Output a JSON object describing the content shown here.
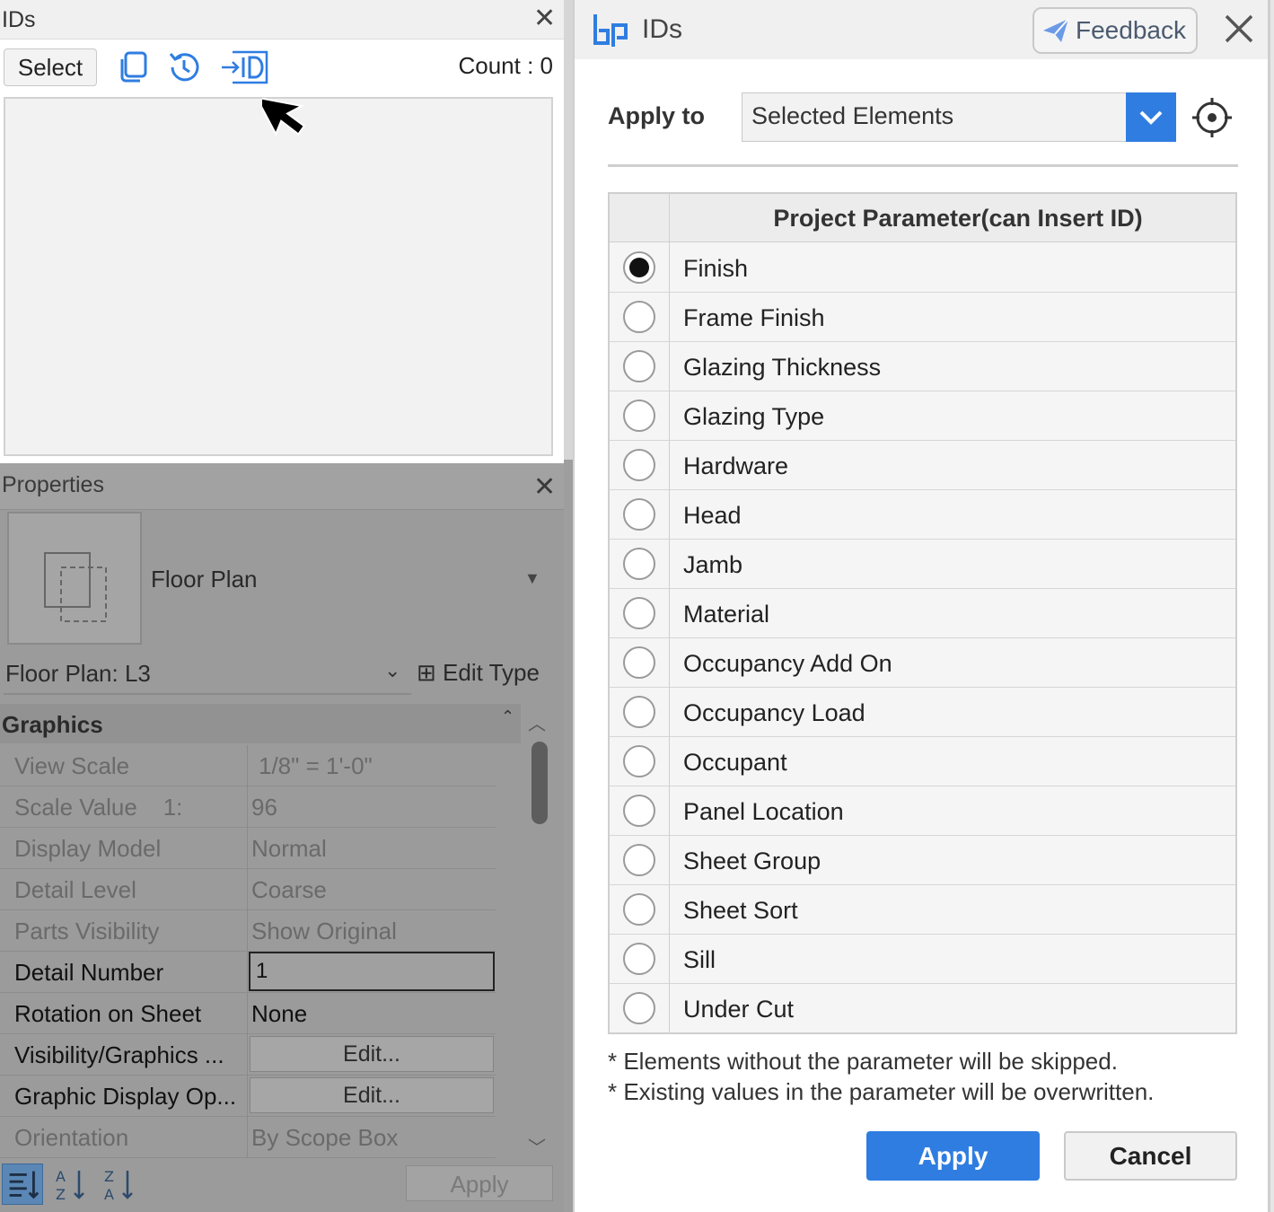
{
  "ids_panel": {
    "title": "IDs",
    "select_label": "Select",
    "count_text": "Count : 0",
    "icons": [
      "copy-icon",
      "history-icon",
      "insert-id-icon",
      "close-icon"
    ]
  },
  "properties": {
    "title": "Properties",
    "type_name": "Floor Plan",
    "view_selector": "Floor Plan: L3",
    "edit_type_label": "Edit Type",
    "section_label": "Graphics",
    "rows": [
      {
        "label": "View Scale",
        "value": "1/8\" = 1'-0\""
      },
      {
        "label": "Scale Value    1:",
        "value": "96"
      },
      {
        "label": "Display Model",
        "value": "Normal"
      },
      {
        "label": "Detail Level",
        "value": "Coarse"
      },
      {
        "label": "Parts Visibility",
        "value": "Show Original"
      },
      {
        "label": "Detail Number",
        "value": "1"
      },
      {
        "label": "Rotation on Sheet",
        "value": "None"
      },
      {
        "label": "Visibility/Graphics ...",
        "value": "Edit..."
      },
      {
        "label": "Graphic Display Op...",
        "value": "Edit..."
      },
      {
        "label": "Orientation",
        "value": "By Scope Box"
      }
    ],
    "apply_label": "Apply"
  },
  "dialog": {
    "title": "IDs",
    "feedback_label": "Feedback",
    "apply_to_label": "Apply to",
    "apply_to_value": "Selected Elements",
    "table_header": "Project Parameter(can Insert ID)",
    "parameters": [
      {
        "label": "Finish",
        "selected": true
      },
      {
        "label": "Frame Finish",
        "selected": false
      },
      {
        "label": "Glazing Thickness",
        "selected": false
      },
      {
        "label": "Glazing Type",
        "selected": false
      },
      {
        "label": "Hardware",
        "selected": false
      },
      {
        "label": "Head",
        "selected": false
      },
      {
        "label": "Jamb",
        "selected": false
      },
      {
        "label": "Material",
        "selected": false
      },
      {
        "label": "Occupancy Add On",
        "selected": false
      },
      {
        "label": "Occupancy Load",
        "selected": false
      },
      {
        "label": "Occupant",
        "selected": false
      },
      {
        "label": "Panel Location",
        "selected": false
      },
      {
        "label": "Sheet Group",
        "selected": false
      },
      {
        "label": "Sheet Sort",
        "selected": false
      },
      {
        "label": "Sill",
        "selected": false
      },
      {
        "label": "Under Cut",
        "selected": false
      }
    ],
    "notes": [
      "* Elements without the parameter will be skipped.",
      "* Existing values in the parameter will be overwritten."
    ],
    "apply_label": "Apply",
    "cancel_label": "Cancel"
  },
  "colors": {
    "accent": "#2f7de1",
    "panel_dim": "#9b9b9b"
  }
}
